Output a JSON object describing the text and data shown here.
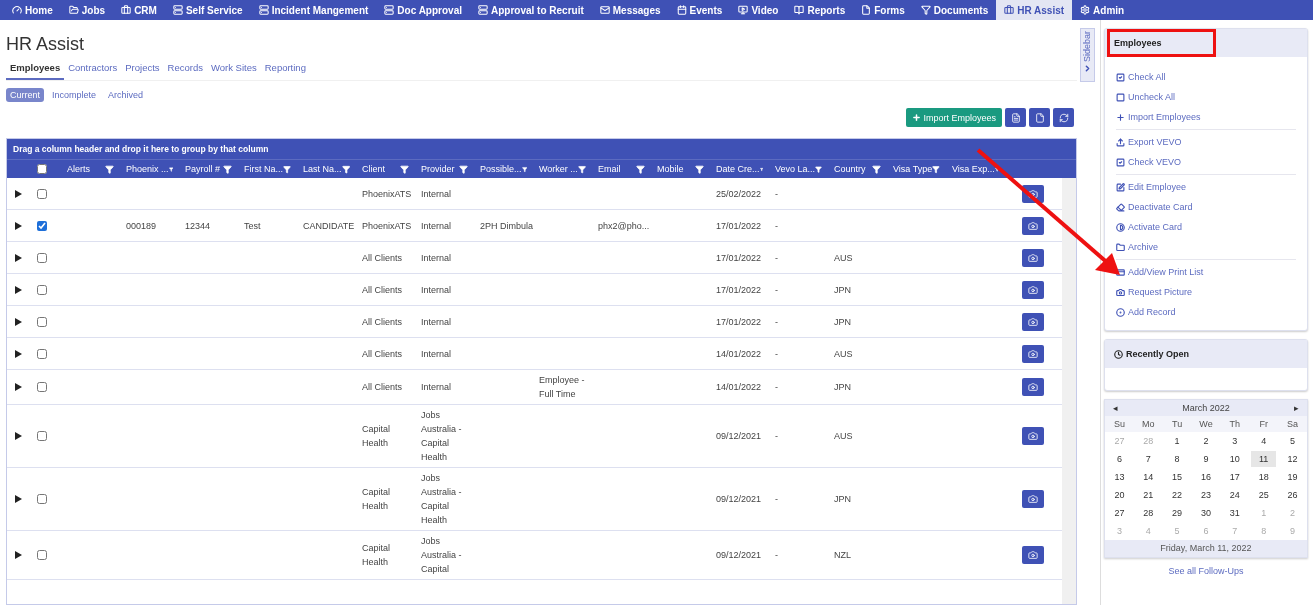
{
  "nav": [
    {
      "label": "Home",
      "selected": false
    },
    {
      "label": "Jobs",
      "selected": false
    },
    {
      "label": "CRM",
      "selected": false
    },
    {
      "label": "Self Service",
      "selected": false
    },
    {
      "label": "Incident Mangement",
      "selected": false
    },
    {
      "label": "Doc Approval",
      "selected": false
    },
    {
      "label": "Approval to Recruit",
      "selected": false
    },
    {
      "label": "Messages",
      "selected": false
    },
    {
      "label": "Events",
      "selected": false
    },
    {
      "label": "Video",
      "selected": false
    },
    {
      "label": "Reports",
      "selected": false
    },
    {
      "label": "Forms",
      "selected": false
    },
    {
      "label": "Documents",
      "selected": false
    },
    {
      "label": "HR Assist",
      "selected": true
    },
    {
      "label": "Admin",
      "selected": false
    }
  ],
  "page_title": "HR Assist",
  "tabs": [
    {
      "label": "Employees",
      "selected": true
    },
    {
      "label": "Contractors",
      "selected": false
    },
    {
      "label": "Projects",
      "selected": false
    },
    {
      "label": "Records",
      "selected": false
    },
    {
      "label": "Work Sites",
      "selected": false
    },
    {
      "label": "Reporting",
      "selected": false
    }
  ],
  "filters": [
    {
      "label": "Current",
      "selected": true
    },
    {
      "label": "Incomplete",
      "selected": false
    },
    {
      "label": "Archived",
      "selected": false
    }
  ],
  "import_button": "Import Employees",
  "table": {
    "group_hint": "Drag a column header and drop it here to group by that column",
    "all_checked": false,
    "columns": [
      "Alerts",
      "Phoenix ...",
      "Payroll #",
      "First Na...",
      "Last Na...",
      "Client",
      "Provider",
      "Possible...",
      "Worker ...",
      "Email",
      "Mobile",
      "Date Cre...",
      "Vevo La...",
      "Country",
      "Visa Type",
      "Visa Exp..."
    ],
    "rows": [
      {
        "checked": false,
        "cells": {
          "client": "PhoenixATS",
          "provider": "Internal",
          "date_created": "25/02/2022",
          "vevo": "-"
        }
      },
      {
        "checked": true,
        "cells": {
          "phoenix": "000189",
          "payroll": "12344",
          "first_name": "Test",
          "last_name": "CANDIDATE",
          "client": "PhoenixATS",
          "provider": "Internal",
          "possible": "2PH Dimbula",
          "email": "phx2@pho...",
          "date_created": "17/01/2022",
          "vevo": "-"
        }
      },
      {
        "checked": false,
        "cells": {
          "client": "All Clients",
          "provider": "Internal",
          "date_created": "17/01/2022",
          "vevo": "-",
          "country": "AUS"
        }
      },
      {
        "checked": false,
        "cells": {
          "client": "All Clients",
          "provider": "Internal",
          "date_created": "17/01/2022",
          "vevo": "-",
          "country": "JPN"
        }
      },
      {
        "checked": false,
        "cells": {
          "client": "All Clients",
          "provider": "Internal",
          "date_created": "17/01/2022",
          "vevo": "-",
          "country": "JPN"
        }
      },
      {
        "checked": false,
        "cells": {
          "client": "All Clients",
          "provider": "Internal",
          "date_created": "14/01/2022",
          "vevo": "-",
          "country": "AUS"
        }
      },
      {
        "checked": false,
        "cells": {
          "client": "All Clients",
          "provider": "Internal",
          "worker": "Employee - Full Time",
          "date_created": "14/01/2022",
          "vevo": "-",
          "country": "JPN"
        }
      },
      {
        "checked": false,
        "cells": {
          "client": "Capital Health",
          "provider": "Jobs Australia - Capital Health",
          "date_created": "09/12/2021",
          "vevo": "-",
          "country": "AUS"
        }
      },
      {
        "checked": false,
        "cells": {
          "client": "Capital Health",
          "provider": "Jobs Australia - Capital Health",
          "date_created": "09/12/2021",
          "vevo": "-",
          "country": "JPN"
        }
      },
      {
        "checked": false,
        "cells": {
          "client": "Capital Health",
          "provider": "Jobs Australia - Capital",
          "date_created": "09/12/2021",
          "vevo": "-",
          "country": "NZL"
        }
      }
    ]
  },
  "sidebar_tab": "Sidebar",
  "actions_panel": {
    "title": "Employees",
    "highlighted": true,
    "groups": [
      [
        "Check All",
        "Uncheck All",
        "Import Employees"
      ],
      [
        "Export VEVO",
        "Check VEVO"
      ],
      [
        "Edit Employee",
        "Deactivate Card",
        "Activate Card",
        "Archive"
      ],
      [
        "Add/View Print List",
        "Request Picture",
        "Add Record"
      ]
    ]
  },
  "annotation_arrow": true,
  "recent_panel": {
    "title": "Recently Open"
  },
  "calendar": {
    "title": "March 2022",
    "prev": "◂",
    "next": "▸",
    "weekdays": [
      "Su",
      "Mo",
      "Tu",
      "We",
      "Th",
      "Fr",
      "Sa"
    ],
    "weeks": [
      [
        {
          "label": "27",
          "other": true,
          "selected": false
        },
        {
          "label": "28",
          "other": true,
          "selected": false
        },
        {
          "label": "1",
          "other": false,
          "selected": false
        },
        {
          "label": "2",
          "other": false,
          "selected": false
        },
        {
          "label": "3",
          "other": false,
          "selected": false
        },
        {
          "label": "4",
          "other": false,
          "selected": false
        },
        {
          "label": "5",
          "other": false,
          "selected": false
        }
      ],
      [
        {
          "label": "6",
          "other": false,
          "selected": false
        },
        {
          "label": "7",
          "other": false,
          "selected": false
        },
        {
          "label": "8",
          "other": false,
          "selected": false
        },
        {
          "label": "9",
          "other": false,
          "selected": false
        },
        {
          "label": "10",
          "other": false,
          "selected": false
        },
        {
          "label": "11",
          "other": false,
          "selected": true
        },
        {
          "label": "12",
          "other": false,
          "selected": false
        }
      ],
      [
        {
          "label": "13",
          "other": false,
          "selected": false
        },
        {
          "label": "14",
          "other": false,
          "selected": false
        },
        {
          "label": "15",
          "other": false,
          "selected": false
        },
        {
          "label": "16",
          "other": false,
          "selected": false
        },
        {
          "label": "17",
          "other": false,
          "selected": false
        },
        {
          "label": "18",
          "other": false,
          "selected": false
        },
        {
          "label": "19",
          "other": false,
          "selected": false
        }
      ],
      [
        {
          "label": "20",
          "other": false,
          "selected": false
        },
        {
          "label": "21",
          "other": false,
          "selected": false
        },
        {
          "label": "22",
          "other": false,
          "selected": false
        },
        {
          "label": "23",
          "other": false,
          "selected": false
        },
        {
          "label": "24",
          "other": false,
          "selected": false
        },
        {
          "label": "25",
          "other": false,
          "selected": false
        },
        {
          "label": "26",
          "other": false,
          "selected": false
        }
      ],
      [
        {
          "label": "27",
          "other": false,
          "selected": false
        },
        {
          "label": "28",
          "other": false,
          "selected": false
        },
        {
          "label": "29",
          "other": false,
          "selected": false
        },
        {
          "label": "30",
          "other": false,
          "selected": false
        },
        {
          "label": "31",
          "other": false,
          "selected": false
        },
        {
          "label": "1",
          "other": true,
          "selected": false
        },
        {
          "label": "2",
          "other": true,
          "selected": false
        }
      ],
      [
        {
          "label": "3",
          "other": true,
          "selected": false
        },
        {
          "label": "4",
          "other": true,
          "selected": false
        },
        {
          "label": "5",
          "other": true,
          "selected": false
        },
        {
          "label": "6",
          "other": true,
          "selected": false
        },
        {
          "label": "7",
          "other": true,
          "selected": false
        },
        {
          "label": "8",
          "other": true,
          "selected": false
        },
        {
          "label": "9",
          "other": true,
          "selected": false
        }
      ]
    ],
    "footer": "Friday, March 11, 2022"
  },
  "follow_ups_link": "See all Follow-Ups"
}
